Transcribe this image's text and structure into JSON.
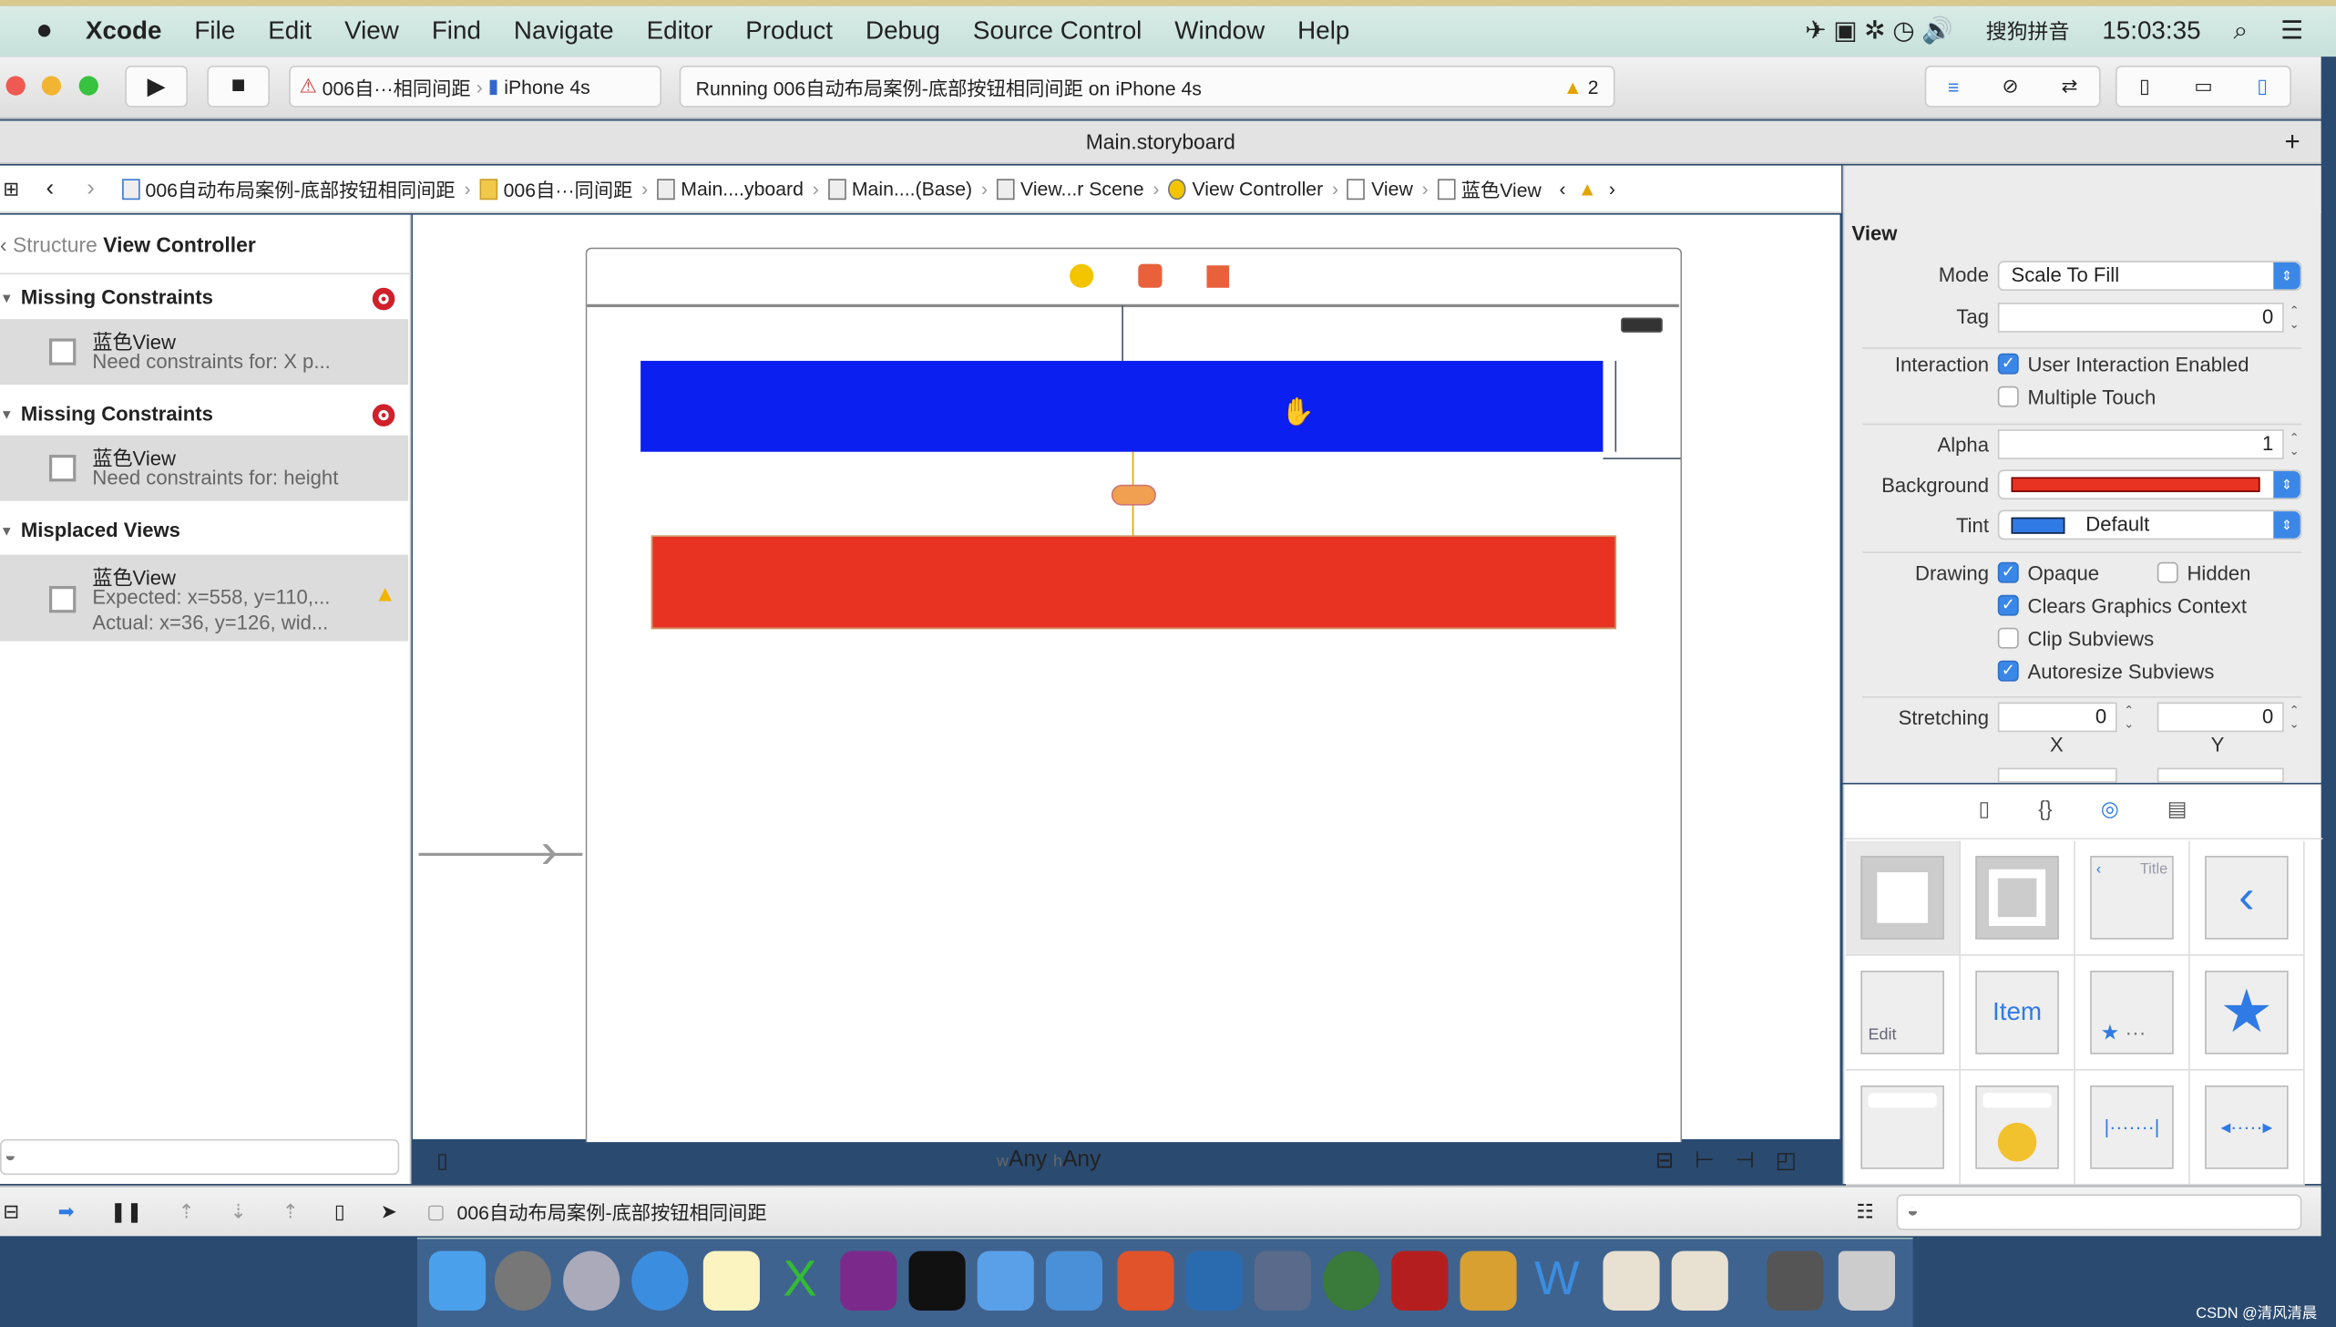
{
  "menubar": {
    "app": "Xcode",
    "items": [
      "File",
      "Edit",
      "View",
      "Find",
      "Navigate",
      "Editor",
      "Product",
      "Debug",
      "Source Control",
      "Window",
      "Help"
    ],
    "input_method": "搜狗拼音",
    "clock": "15:03:35"
  },
  "toolbar": {
    "scheme": "006自···相同间距",
    "device": "iPhone 4s",
    "status": "Running 006自动布局案例-底部按钮相同间距 on iPhone 4s",
    "warning_count": "2"
  },
  "tab": {
    "title": "Main.storyboard"
  },
  "jumpbar": [
    "006自动布局案例-底部按钮相同间距",
    "006自···同间距",
    "Main....yboard",
    "Main....(Base)",
    "View...r Scene",
    "View Controller",
    "View",
    "蓝色View"
  ],
  "issues": {
    "back": "Structure",
    "title": "View Controller",
    "groups": [
      {
        "title": "Missing Constraints",
        "type": "error",
        "item": {
          "name": "蓝色View",
          "detail": "Need constraints for: X p..."
        }
      },
      {
        "title": "Missing Constraints",
        "type": "error",
        "item": {
          "name": "蓝色View",
          "detail": "Need constraints for: height"
        }
      },
      {
        "title": "Misplaced Views",
        "type": "warning",
        "item": {
          "name": "蓝色View",
          "detail": "Expected: x=558, y=110,...",
          "detail2": "Actual: x=36, y=126, wid..."
        }
      }
    ]
  },
  "canvas": {
    "size_w": "w",
    "size_w_val": "Any",
    "size_h": "h",
    "size_h_val": "Any",
    "blue_view_color": "#0a1ff0",
    "red_view_color": "#e83323"
  },
  "inspector": {
    "section": "View",
    "mode_label": "Mode",
    "mode": "Scale To Fill",
    "tag_label": "Tag",
    "tag": "0",
    "interaction_label": "Interaction",
    "user_interaction": {
      "label": "User Interaction Enabled",
      "checked": true
    },
    "multiple_touch": {
      "label": "Multiple Touch",
      "checked": false
    },
    "alpha_label": "Alpha",
    "alpha": "1",
    "background_label": "Background",
    "background_color": "#e83323",
    "tint_label": "Tint",
    "tint": "Default",
    "tint_color": "#2f7ae5",
    "drawing_label": "Drawing",
    "opaque": {
      "label": "Opaque",
      "checked": true
    },
    "hidden": {
      "label": "Hidden",
      "checked": false
    },
    "clears": {
      "label": "Clears Graphics Context",
      "checked": true
    },
    "clip": {
      "label": "Clip Subviews",
      "checked": false
    },
    "autoresize": {
      "label": "Autoresize Subviews",
      "checked": true
    },
    "stretching_label": "Stretching",
    "stretch_x": "0",
    "stretch_y": "0",
    "x_label": "X",
    "y_label": "Y"
  },
  "library": {
    "item_label": "Item",
    "title_label": "Title",
    "edit_label": "Edit"
  },
  "debugbar": {
    "target": "006自动布局案例-底部按钮相同间距"
  },
  "watermark": "CSDN @清风清晨"
}
